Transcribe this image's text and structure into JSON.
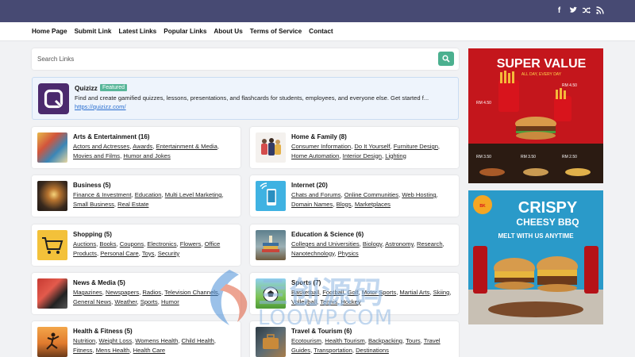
{
  "social": {
    "icons": [
      "facebook-icon",
      "twitter-icon",
      "shuffle-icon",
      "rss-icon"
    ]
  },
  "nav": {
    "items": [
      "Home Page",
      "Submit Link",
      "Latest Links",
      "Popular Links",
      "About Us",
      "Terms of Service",
      "Contact"
    ]
  },
  "search": {
    "placeholder": "Search Links"
  },
  "featured": {
    "name": "Quizizz",
    "badge": "Featured",
    "description": "Find and create gamified quizzes, lessons, presentations, and flashcards for students, employees, and everyone else. Get started f...",
    "url": "https://quizizz.com/"
  },
  "categories": [
    {
      "title": "Arts & Entertainment (16)",
      "links": [
        "Actors and Actresses",
        "Awards",
        "Entertainment & Media",
        "Movies and Films",
        "Humor and Jokes"
      ]
    },
    {
      "title": "Home & Family (8)",
      "links": [
        "Consumer Information",
        "Do It Yourself",
        "Furniture Design",
        "Home Automation",
        "Interior Design",
        "Lighting"
      ]
    },
    {
      "title": "Business (5)",
      "links": [
        "Finance & Investment",
        "Education",
        "Multi Level Marketing",
        "Small Business",
        "Real Estate"
      ]
    },
    {
      "title": "Internet (20)",
      "links": [
        "Chats and Forums",
        "Online Communities",
        "Web Hosting",
        "Domain Names",
        "Blogs",
        "Marketplaces"
      ]
    },
    {
      "title": "Shopping (5)",
      "links": [
        "Auctions",
        "Books",
        "Coupons",
        "Electronics",
        "Flowers",
        "Office Products",
        "Personal Care",
        "Toys",
        "Security"
      ]
    },
    {
      "title": "Education & Science (6)",
      "links": [
        "Colleges and Universities",
        "Biology",
        "Astronomy",
        "Research",
        "Nanotechnology",
        "Physics"
      ]
    },
    {
      "title": "News & Media (5)",
      "links": [
        "Magazines",
        "Newspapers",
        "Radios",
        "Television Channels",
        "General News",
        "Weather",
        "Sports",
        "Humor"
      ]
    },
    {
      "title": "Sports (7)",
      "links": [
        "Basketball",
        "Football",
        "Golf",
        "Motor Sports",
        "Martial Arts",
        "Skiing",
        "Volleyball",
        "Tennis",
        "Hockey"
      ]
    },
    {
      "title": "Health & Fitness (5)",
      "links": [
        "Nutrition",
        "Weight Loss",
        "Womens Health",
        "Child Health",
        "Fitness",
        "Mens Health",
        "Health Care"
      ]
    },
    {
      "title": "Travel & Tourism (6)",
      "links": [
        "Ecotourism",
        "Health Tourism",
        "Backpacking",
        "Tours",
        "Travel Guides",
        "Transportation",
        "Destinations"
      ]
    }
  ],
  "ads": {
    "ad1": {
      "headline": "SUPER VALUE",
      "sub": "ALL DAY, EVERY DAY",
      "prices": [
        "RM 4.50",
        "RM 4.50",
        "RM 3.50",
        "RM 3.50",
        "RM 2.50"
      ]
    },
    "ad2": {
      "headline1": "CRISPY",
      "headline2": "CHEESY BBQ",
      "tagline": "MELT WITH US ANYTIME"
    }
  },
  "watermark": {
    "cn": "亖创源码",
    "en": "LOOWP.COM"
  }
}
